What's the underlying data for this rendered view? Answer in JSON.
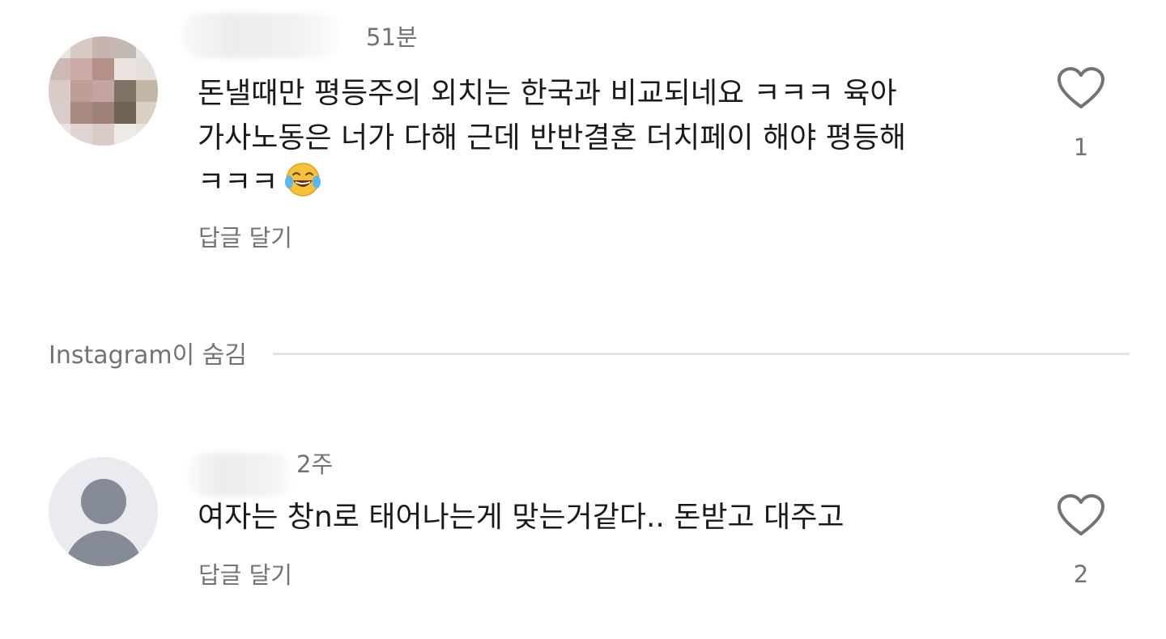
{
  "comments": [
    {
      "time": "51분",
      "text_lines": [
        "돈낼때만 평등주의 외치는 한국과 비교되네요 ㅋㅋㅋ 육아",
        "가사노동은 너가 다해 근데 반반결혼 더치페이 해야 평등해",
        "ㅋㅋㅋ"
      ],
      "emoji": "face-with-tears-of-joy",
      "reply_label": "답글 달기",
      "like_count": "1"
    },
    {
      "time": "2주",
      "text_lines": [
        "여자는 창n로 태어나는게 맞는거같다.. 돈받고 대주고"
      ],
      "reply_label": "답글 달기",
      "like_count": "2"
    }
  ],
  "hidden_section": {
    "label": "Instagram이 숨김"
  },
  "colors": {
    "text_primary": "#1a1a1a",
    "text_secondary": "#737373",
    "divider": "#e3e3e3",
    "avatar_placeholder": "#858c97"
  }
}
